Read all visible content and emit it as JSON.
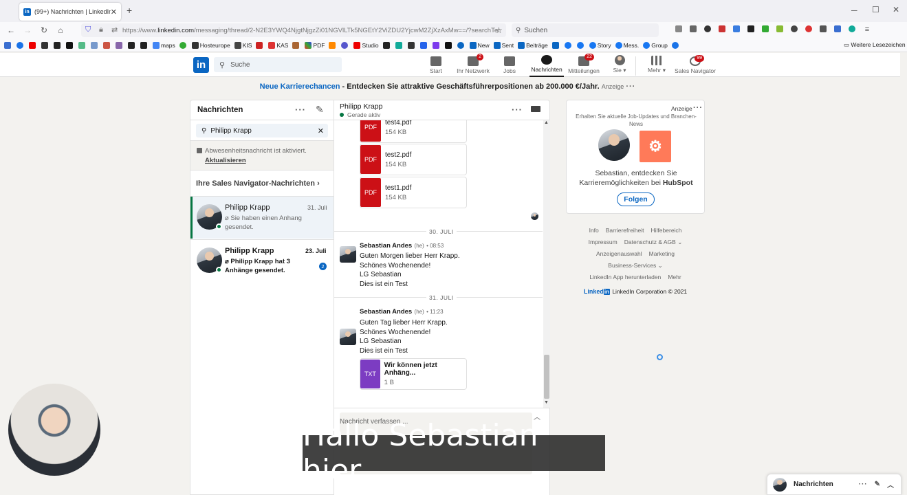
{
  "browser": {
    "tab_title": "(99+) Nachrichten | LinkedIn",
    "new_tab": "+",
    "url_prefix": "https://www.",
    "url_domain": "linkedin.com",
    "url_rest": "/messaging/thread/2-N2E3YWQ4NjgtNjgzZi01NGVlLTk5NGEtY2ViZDU2YjcwM2ZjXzAxMw==/?searchTer",
    "search_placeholder": "Suchen",
    "bookmarks": [
      "maps",
      "Hosteurope",
      "KIS",
      "KAS",
      "PDF",
      "Studio",
      "New",
      "Sent",
      "Beiträge",
      "Story",
      "Mess.",
      "Group"
    ],
    "bookmarks_more": "Weitere Lesezeichen"
  },
  "linkedin": {
    "logo": "in",
    "search_placeholder": "Suche",
    "nav": [
      {
        "label": "Start",
        "badge": ""
      },
      {
        "label": "Ihr Netzwerk",
        "badge": "2"
      },
      {
        "label": "Jobs",
        "badge": ""
      },
      {
        "label": "Nachrichten",
        "badge": ""
      },
      {
        "label": "Mitteilungen",
        "badge": "22"
      },
      {
        "label": "Sie",
        "badge": ""
      },
      {
        "label": "Mehr",
        "badge": ""
      },
      {
        "label": "Sales Navigator",
        "badge": "99"
      }
    ]
  },
  "banner": {
    "link": "Neue Karrierechancen",
    "text": " - Entdecken Sie attraktive Geschäftsführerpositionen ab 200.000 €/Jahr.",
    "ad": "Anzeige"
  },
  "messaging": {
    "title": "Nachrichten",
    "search_value": "Philipp Krapp",
    "away_notice": "Abwesenheitsnachricht ist aktiviert.",
    "away_link": "Aktualisieren",
    "sales_nav_header": "Ihre Sales Navigator-Nachrichten",
    "conversations": [
      {
        "name": "Philipp Krapp",
        "date": "31. Juli",
        "preview": "Sie haben einen Anhang gesendet.",
        "unread": ""
      },
      {
        "name": "Philipp Krapp",
        "date": "23. Juli",
        "preview": "Philipp Krapp hat 3 Anhänge gesendet.",
        "unread": "2"
      }
    ]
  },
  "thread": {
    "name": "Philipp Krapp",
    "status": "Gerade aktiv",
    "files": [
      {
        "icon": "PDF",
        "name": "test4.pdf",
        "size": "154 KB"
      },
      {
        "icon": "PDF",
        "name": "test2.pdf",
        "size": "154 KB"
      },
      {
        "icon": "PDF",
        "name": "test1.pdf",
        "size": "154 KB"
      }
    ],
    "groups": [
      {
        "date": "30. JULI",
        "sender": "Sebastian Andes",
        "pronoun": "(he)",
        "time": "• 08:53",
        "lines": [
          "Guten Morgen lieber Herr Krapp.",
          "Schönes Wochenende!",
          "LG Sebastian",
          "Dies ist ein Test"
        ]
      },
      {
        "date": "31. JULI",
        "sender": "Sebastian Andes",
        "pronoun": "(he)",
        "time": "• 11:23",
        "lines": [
          "Guten Tag lieber Herr Krapp.",
          "Schönes Wochenende!",
          "LG Sebastian",
          "Dies ist ein Test"
        ]
      }
    ],
    "attachment": {
      "icon": "TXT",
      "name": "Wir können jetzt Anhäng...",
      "size": "1 B"
    },
    "compose_placeholder": "Nachricht verfassen ..."
  },
  "ad_card": {
    "ad_label": "Anzeige",
    "subtitle": "Erhalten Sie aktuelle Job-Updates und Branchen-News",
    "text_pre": "Sebastian, entdecken Sie Karrieremöglichkeiten bei ",
    "company": "HubSpot",
    "follow": "Folgen"
  },
  "footer": {
    "row1": [
      "Info",
      "Barrierefreiheit",
      "Hilfebereich"
    ],
    "row2": [
      "Impressum",
      "Datenschutz & AGB"
    ],
    "row3": [
      "Anzeigenauswahl",
      "Marketing"
    ],
    "row4": [
      "Business-Services"
    ],
    "row5": [
      "LinkedIn App herunterladen",
      "Mehr"
    ],
    "brand": "Linked",
    "brand_in": "in",
    "copyright": "LinkedIn Corporation © 2021"
  },
  "subtitle": "Hallo Sebastian hier.",
  "dock": {
    "title": "Nachrichten"
  },
  "colors": {
    "linkedin_blue": "#0a66c2",
    "badge_red": "#cc1016",
    "online_green": "#057642",
    "hubspot_orange": "#ff7a59",
    "txt_purple": "#7c3cc2"
  }
}
